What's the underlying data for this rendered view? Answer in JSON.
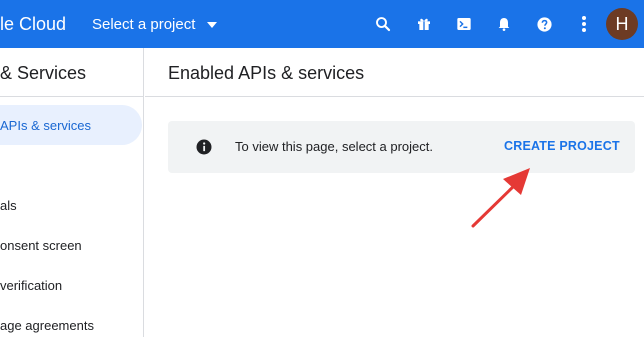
{
  "topbar": {
    "brand": "le Cloud",
    "project_picker": "Select a project",
    "avatar_letter": "H",
    "icons": [
      "search-icon",
      "gift-icon",
      "cloud-shell-icon",
      "notifications-bell-icon",
      "help-icon",
      "more-vert-icon"
    ]
  },
  "sidebar": {
    "title": "& Services",
    "items": [
      {
        "label": "APIs & services",
        "active": true
      },
      {
        "label": "",
        "active": false
      },
      {
        "label": "als",
        "active": false
      },
      {
        "label": "onsent screen",
        "active": false
      },
      {
        "label": "verification",
        "active": false
      },
      {
        "label": "age agreements",
        "active": false
      }
    ]
  },
  "main": {
    "title": "Enabled APIs & services",
    "banner": {
      "message": "To view this page, select a project.",
      "action": "CREATE PROJECT"
    }
  },
  "colors": {
    "topbar": "#1a73e8",
    "active_nav_bg": "#e8f0fe",
    "active_nav_text": "#1967d2",
    "link": "#1a73e8",
    "arrow": "#e53935",
    "avatar": "#6d3b24"
  }
}
